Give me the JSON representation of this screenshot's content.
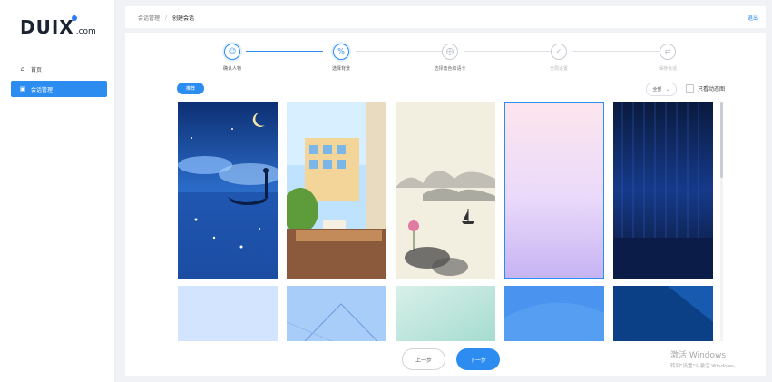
{
  "brand": {
    "logo_main": "DUI",
    "logo_x": "X",
    "logo_suffix": ".com"
  },
  "sidebar": {
    "items": [
      {
        "label": "首页",
        "icon": "home-icon"
      },
      {
        "label": "会话管理",
        "icon": "session-icon",
        "active": true
      }
    ]
  },
  "header": {
    "breadcrumb": [
      "会话管理",
      "创建会话"
    ],
    "separator": "/",
    "logout_label": "退出"
  },
  "steps": [
    {
      "label": "确认人物",
      "state": "done",
      "icon": "person-icon"
    },
    {
      "label": "选择背景",
      "state": "current",
      "icon": "image-icon"
    },
    {
      "label": "选择角色和语卡",
      "state": "next",
      "icon": "card-icon"
    },
    {
      "label": "全局设置",
      "state": "pending",
      "icon": "check-icon"
    },
    {
      "label": "保存会话",
      "state": "pending",
      "icon": "save-icon"
    }
  ],
  "toolbar": {
    "tag_label": "推荐",
    "select_value": "全部",
    "checkbox_label": "只看动态图"
  },
  "gallery": {
    "selected_index": 3,
    "items": [
      "night-lake-boat-image",
      "classroom-window-image",
      "ink-landscape-image",
      "pink-purple-gradient-image",
      "blue-curtain-stage-image",
      "light-blue-image",
      "blue-geometric-image",
      "mint-gradient-image",
      "blue-wave-image",
      "dark-blue-image"
    ]
  },
  "footer": {
    "prev_label": "上一步",
    "next_label": "下一步"
  },
  "watermark": {
    "line1": "激活 Windows",
    "line2": "转到\"设置\"以激活 Windows。"
  },
  "colors": {
    "primary": "#2d8cf0",
    "background": "#f1f2f6"
  }
}
